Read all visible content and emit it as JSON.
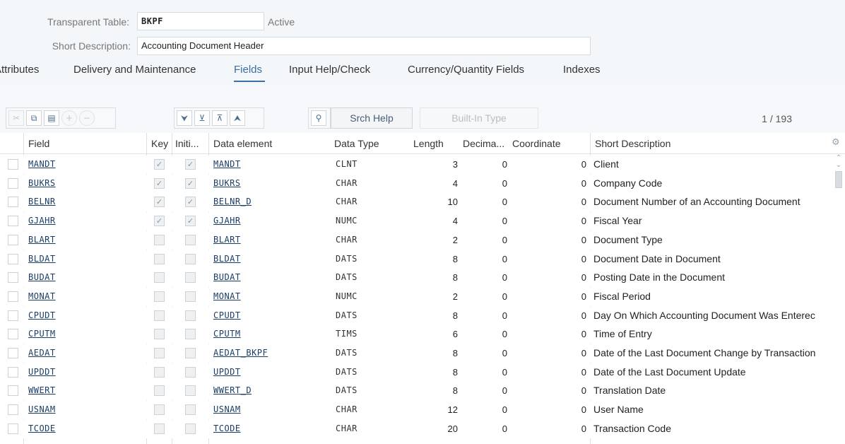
{
  "header": {
    "table_label": "Transparent Table:",
    "table_value": "BKPF",
    "status": "Active",
    "desc_label": "Short Description:",
    "desc_value": "Accounting Document Header"
  },
  "tabs": [
    {
      "label": "Attributes",
      "active": false
    },
    {
      "label": "Delivery and Maintenance",
      "active": false
    },
    {
      "label": "Fields",
      "active": true
    },
    {
      "label": "Input Help/Check",
      "active": false
    },
    {
      "label": "Currency/Quantity Fields",
      "active": false
    },
    {
      "label": "Indexes",
      "active": false
    }
  ],
  "toolbar": {
    "srch_help": "Srch Help",
    "builtin_type": "Built-In Type",
    "pager": "1  /  193"
  },
  "columns": {
    "field": "Field",
    "key": "Key",
    "initial": "Initi...",
    "data_element": "Data element",
    "data_type": "Data Type",
    "length": "Length",
    "decimals": "Decima...",
    "coordinate": "Coordinate",
    "short_description": "Short Description"
  },
  "rows": [
    {
      "field": "MANDT",
      "key": true,
      "initial": true,
      "data_element": "MANDT",
      "data_type": "CLNT",
      "length": "3",
      "decimals": "0",
      "coordinate": "0",
      "description": "Client"
    },
    {
      "field": "BUKRS",
      "key": true,
      "initial": true,
      "data_element": "BUKRS",
      "data_type": "CHAR",
      "length": "4",
      "decimals": "0",
      "coordinate": "0",
      "description": "Company Code"
    },
    {
      "field": "BELNR",
      "key": true,
      "initial": true,
      "data_element": "BELNR_D",
      "data_type": "CHAR",
      "length": "10",
      "decimals": "0",
      "coordinate": "0",
      "description": "Document Number of an Accounting Document"
    },
    {
      "field": "GJAHR",
      "key": true,
      "initial": true,
      "data_element": "GJAHR",
      "data_type": "NUMC",
      "length": "4",
      "decimals": "0",
      "coordinate": "0",
      "description": "Fiscal Year"
    },
    {
      "field": "BLART",
      "key": false,
      "initial": false,
      "data_element": "BLART",
      "data_type": "CHAR",
      "length": "2",
      "decimals": "0",
      "coordinate": "0",
      "description": "Document Type"
    },
    {
      "field": "BLDAT",
      "key": false,
      "initial": false,
      "data_element": "BLDAT",
      "data_type": "DATS",
      "length": "8",
      "decimals": "0",
      "coordinate": "0",
      "description": "Document Date in Document"
    },
    {
      "field": "BUDAT",
      "key": false,
      "initial": false,
      "data_element": "BUDAT",
      "data_type": "DATS",
      "length": "8",
      "decimals": "0",
      "coordinate": "0",
      "description": "Posting Date in the Document"
    },
    {
      "field": "MONAT",
      "key": false,
      "initial": false,
      "data_element": "MONAT",
      "data_type": "NUMC",
      "length": "2",
      "decimals": "0",
      "coordinate": "0",
      "description": "Fiscal Period"
    },
    {
      "field": "CPUDT",
      "key": false,
      "initial": false,
      "data_element": "CPUDT",
      "data_type": "DATS",
      "length": "8",
      "decimals": "0",
      "coordinate": "0",
      "description": "Day On Which Accounting Document Was Enterec"
    },
    {
      "field": "CPUTM",
      "key": false,
      "initial": false,
      "data_element": "CPUTM",
      "data_type": "TIMS",
      "length": "6",
      "decimals": "0",
      "coordinate": "0",
      "description": "Time of Entry"
    },
    {
      "field": "AEDAT",
      "key": false,
      "initial": false,
      "data_element": "AEDAT_BKPF",
      "data_type": "DATS",
      "length": "8",
      "decimals": "0",
      "coordinate": "0",
      "description": "Date of the Last Document Change by Transaction"
    },
    {
      "field": "UPDDT",
      "key": false,
      "initial": false,
      "data_element": "UPDDT",
      "data_type": "DATS",
      "length": "8",
      "decimals": "0",
      "coordinate": "0",
      "description": "Date of the Last Document Update"
    },
    {
      "field": "WWERT",
      "key": false,
      "initial": false,
      "data_element": "WWERT_D",
      "data_type": "DATS",
      "length": "8",
      "decimals": "0",
      "coordinate": "0",
      "description": "Translation Date"
    },
    {
      "field": "USNAM",
      "key": false,
      "initial": false,
      "data_element": "USNAM",
      "data_type": "CHAR",
      "length": "12",
      "decimals": "0",
      "coordinate": "0",
      "description": "User Name"
    },
    {
      "field": "TCODE",
      "key": false,
      "initial": false,
      "data_element": "TCODE",
      "data_type": "CHAR",
      "length": "20",
      "decimals": "0",
      "coordinate": "0",
      "description": "Transaction Code"
    }
  ]
}
